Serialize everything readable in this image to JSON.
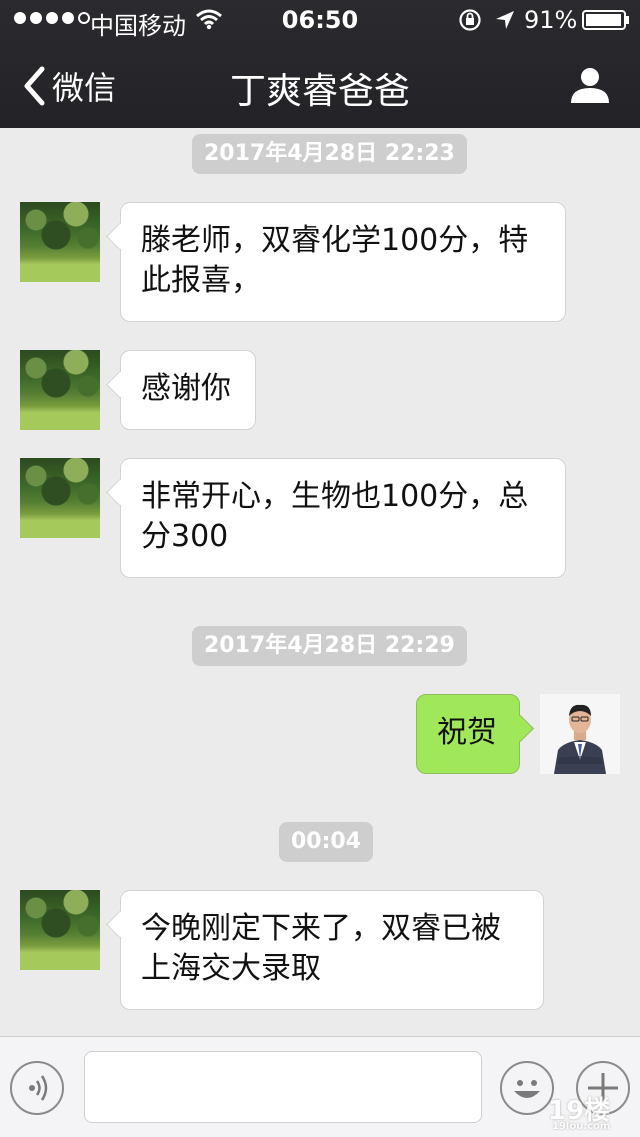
{
  "status_bar": {
    "carrier": "中国移动",
    "time": "06:50",
    "battery": "91%"
  },
  "nav": {
    "back_label": "微信",
    "title": "丁爽睿爸爸"
  },
  "messages": [
    {
      "type": "timestamp",
      "text": "2017年4月28日 22:23"
    },
    {
      "type": "message",
      "side": "left",
      "text": "滕老师，双睿化学100分，特此报喜，"
    },
    {
      "type": "message",
      "side": "left",
      "text": "感谢你"
    },
    {
      "type": "message",
      "side": "left",
      "text": "非常开心，生物也100分，总分300"
    },
    {
      "type": "timestamp",
      "text": "2017年4月28日 22:29"
    },
    {
      "type": "message",
      "side": "right",
      "text": "祝贺"
    },
    {
      "type": "timestamp",
      "text": "00:04"
    },
    {
      "type": "message",
      "side": "left",
      "text": "今晚刚定下来了，双睿已被上海交大录取"
    }
  ],
  "input": {
    "placeholder": ""
  },
  "watermark": {
    "main": "19楼",
    "sub": "19lou.com"
  },
  "colors": {
    "topbar": "#2a2a2e",
    "background": "#ebebeb",
    "bubble_in": "#ffffff",
    "bubble_out": "#a0e75a"
  },
  "icons": [
    "wifi-icon",
    "lock-rotation-icon",
    "location-arrow-icon",
    "battery-icon",
    "back-chevron-icon",
    "profile-icon",
    "voice-icon",
    "emoji-icon",
    "plus-icon"
  ]
}
